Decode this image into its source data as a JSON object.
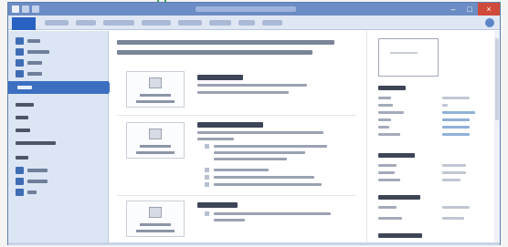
{
  "window": {
    "title": "",
    "file_tab_label": "",
    "minimize_symbol": "–",
    "maximize_symbol": "□",
    "close_symbol": "×"
  },
  "ribbon": {
    "tabs": [
      {
        "label": ""
      },
      {
        "label": ""
      },
      {
        "label": ""
      },
      {
        "label": ""
      },
      {
        "label": ""
      },
      {
        "label": ""
      },
      {
        "label": ""
      },
      {
        "label": ""
      }
    ]
  },
  "nav": {
    "items": [
      {
        "label": "",
        "icon": "save-icon"
      },
      {
        "label": "",
        "icon": "save-as-icon"
      },
      {
        "label": "",
        "icon": "open-icon"
      },
      {
        "label": "",
        "icon": "close-doc-icon"
      },
      {
        "label": "",
        "icon": "info-icon",
        "selected": true
      },
      {
        "label": ""
      },
      {
        "label": ""
      },
      {
        "label": ""
      },
      {
        "label": ""
      },
      {
        "label": ""
      },
      {
        "label": "",
        "icon": "help-icon"
      },
      {
        "label": "",
        "icon": "options-icon"
      },
      {
        "label": "",
        "icon": "exit-icon"
      }
    ]
  },
  "main": {
    "title": "",
    "sections": [
      {
        "heading": "",
        "button_label": "",
        "description": ""
      },
      {
        "heading": "",
        "button_label": "",
        "description": "",
        "bullets": [
          "",
          "",
          "",
          ""
        ]
      },
      {
        "heading": "",
        "button_label": "",
        "description": ""
      }
    ]
  },
  "properties": {
    "heading": "",
    "rows": [
      {
        "key": "",
        "value": ""
      },
      {
        "key": "",
        "value": ""
      },
      {
        "key": "",
        "value": ""
      },
      {
        "key": "",
        "value": ""
      },
      {
        "key": "",
        "value": ""
      },
      {
        "key": "",
        "value": ""
      }
    ],
    "related_dates_heading": "",
    "related_people_heading": ""
  },
  "colors": {
    "titlebar": "#6b8cc4",
    "file_tab": "#2a62c4",
    "nav_selected": "#3c6fc2",
    "nav_background": "#dbe5f3",
    "close_button": "#d04a3c"
  }
}
